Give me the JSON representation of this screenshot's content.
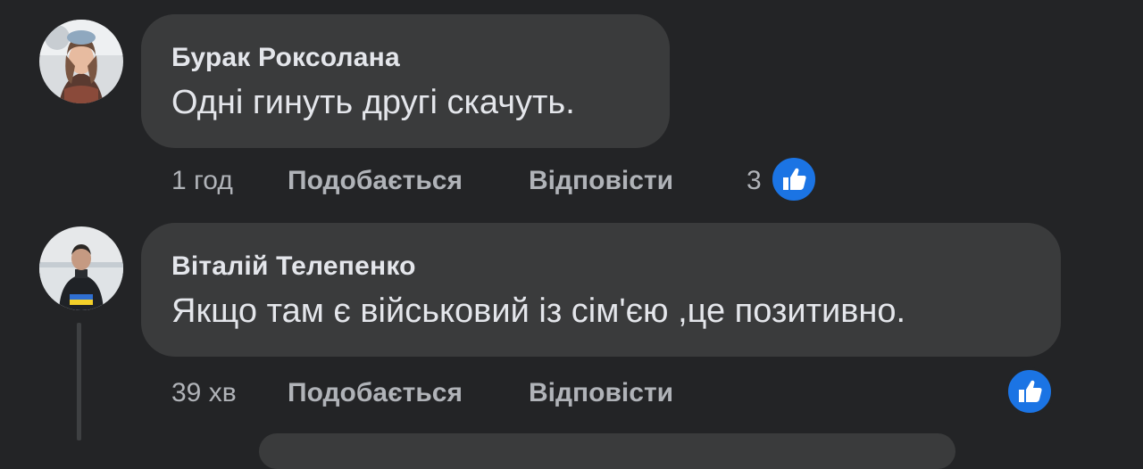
{
  "comments": [
    {
      "author": "Бурак Роксолана",
      "text": "Одні гинуть другі скачуть.",
      "time": "1 год",
      "like_label": "Подобається",
      "reply_label": "Відповісти",
      "reaction_count": "3",
      "reaction_icon": "thumbs-up-icon"
    },
    {
      "author": "Віталій Телепенко",
      "text": "Якщо там є військовий із сім'єю ,це позитивно.",
      "time": "39 хв",
      "like_label": "Подобається",
      "reply_label": "Відповісти",
      "reaction_icon": "thumbs-up-icon"
    }
  ],
  "colors": {
    "background": "#232426",
    "bubble": "#3a3b3c",
    "text": "#e4e6eb",
    "secondary_text": "#b0b3b8",
    "like_blue": "#1b74e4"
  }
}
